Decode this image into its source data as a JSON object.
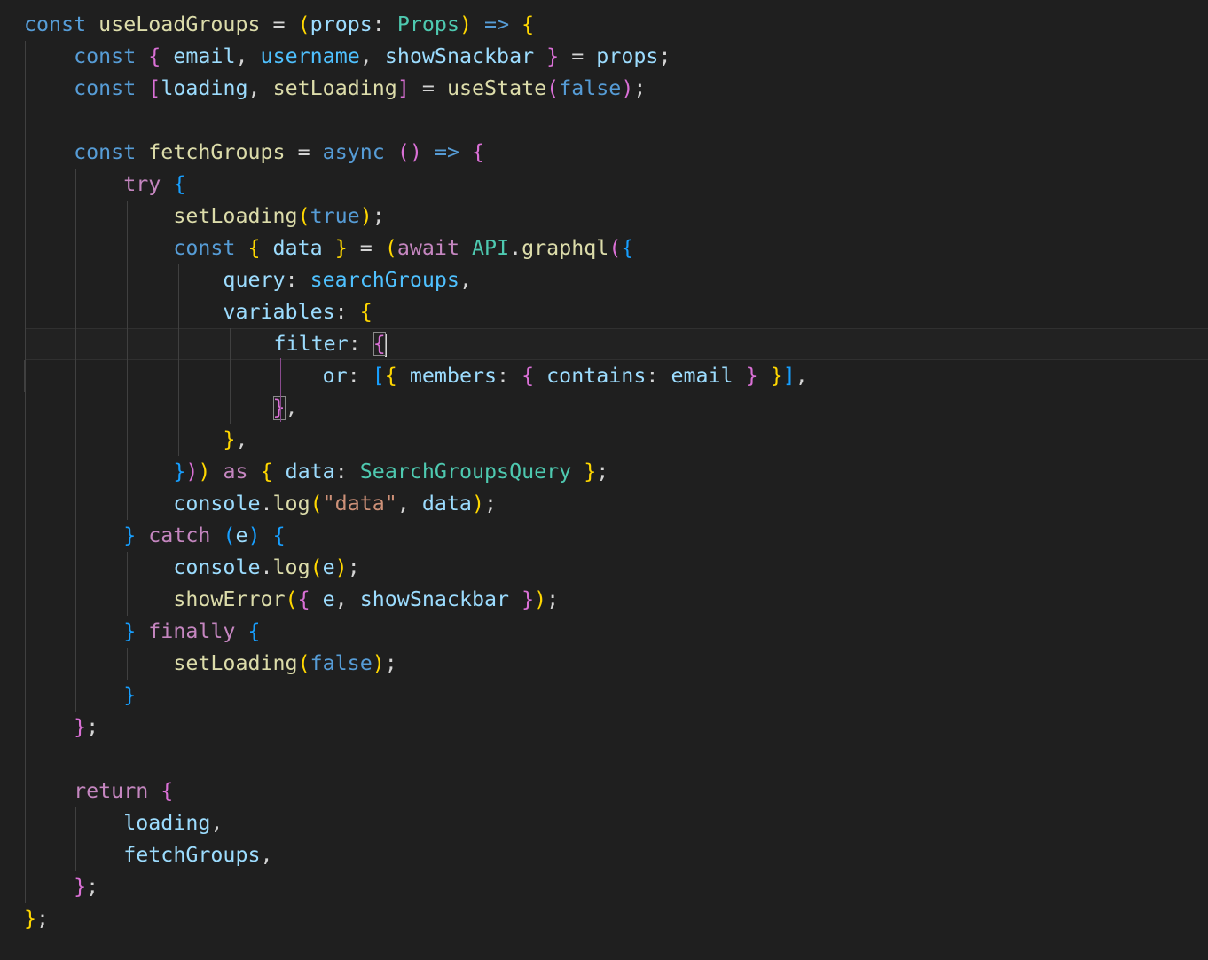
{
  "editor": {
    "language": "typescript",
    "theme": "dark",
    "cursor_line": 11,
    "lines": [
      "const useLoadGroups = (props: Props) => {",
      "    const { email, username, showSnackbar } = props;",
      "    const [loading, setLoading] = useState(false);",
      "",
      "    const fetchGroups = async () => {",
      "        try {",
      "            setLoading(true);",
      "            const { data } = (await API.graphql({",
      "                query: searchGroups,",
      "                variables: {",
      "                    filter: {",
      "                        or: [{ members: { contains: email } }],",
      "                    },",
      "                },",
      "            })) as { data: SearchGroupsQuery };",
      "            console.log(\"data\", data);",
      "        } catch (e) {",
      "            console.log(e);",
      "            showError({ e, showSnackbar });",
      "        } finally {",
      "            setLoading(false);",
      "        }",
      "    };",
      "",
      "    return {",
      "        loading,",
      "        fetchGroups,",
      "    };",
      "};"
    ]
  },
  "colors": {
    "background": "#1f1f1f",
    "keyword": "#569cd6",
    "control": "#c586c0",
    "function": "#dcdcaa",
    "variable": "#9cdcfe",
    "type": "#4ec9b0",
    "string": "#ce9178",
    "bracket1": "#ffd700",
    "bracket2": "#da70d6",
    "bracket3": "#179fff"
  }
}
